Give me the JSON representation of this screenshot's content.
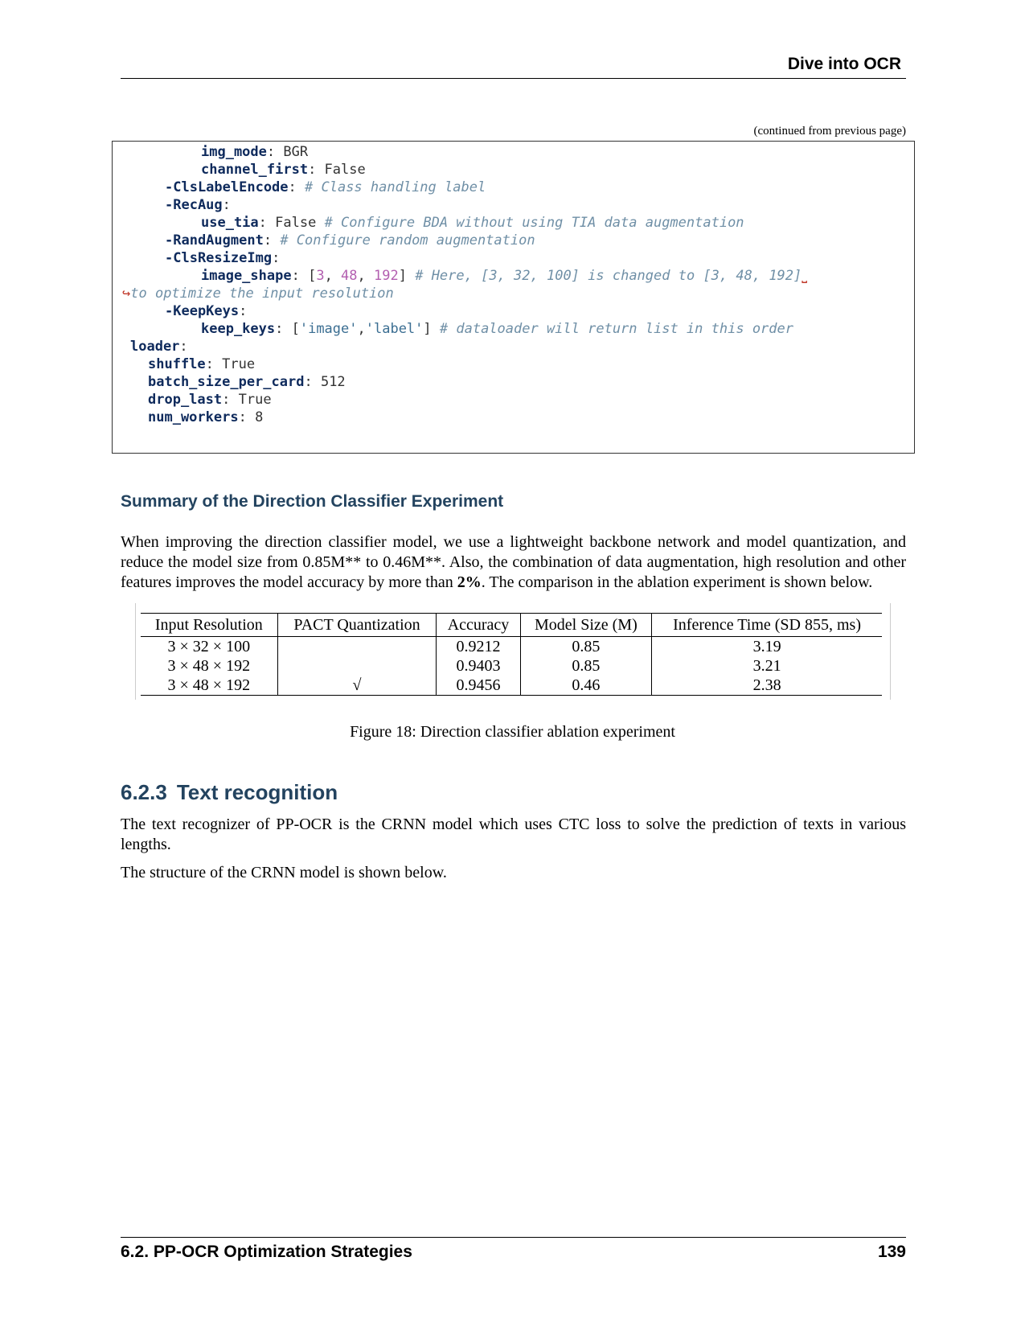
{
  "header": {
    "title": "Dive into OCR"
  },
  "continued_note": "(continued from previous page)",
  "code": {
    "line1": {
      "key": "img_mode",
      "value": " BGR"
    },
    "line2": {
      "key": "channel_first",
      "value": " False"
    },
    "line3": {
      "key": "-ClsLabelEncode",
      "comment": "# Class handling label"
    },
    "line4": {
      "key": "-RecAug"
    },
    "line5": {
      "key": "use_tia",
      "value": " False ",
      "comment": "# Configure BDA without using TIA data augmentation"
    },
    "line6": {
      "key": "-RandAugment",
      "comment": "# Configure random augmentation"
    },
    "line7": {
      "key": "-ClsResizeImg"
    },
    "line8": {
      "key": "image_shape",
      "n1": "3",
      "n2": "48",
      "n3": "192",
      "comment": "# Here, [3, 32, 100] is changed to [3, 48, 192]",
      "wrap_mark": "⎵"
    },
    "line9": {
      "arrow": "↪",
      "comment": "to optimize the input resolution"
    },
    "line10": {
      "key": "-KeepKeys"
    },
    "line11": {
      "key": "keep_keys",
      "s1": "'image'",
      "s2": "'label'",
      "comment": "# dataloader will return list in this order"
    },
    "line12": {
      "key": "loader"
    },
    "line13": {
      "key": "shuffle",
      "value": " True"
    },
    "line14": {
      "key": "batch_size_per_card",
      "value": " 512"
    },
    "line15": {
      "key": "drop_last",
      "value": " True"
    },
    "line16": {
      "key": "num_workers",
      "value": " 8"
    }
  },
  "subsection": {
    "title": "Summary of the Direction Classifier Experiment"
  },
  "summary": {
    "text_before_bold": "When improving the direction classifier model, we use a lightweight backbone network and model quantization, and reduce the model size from 0.85M** to 0.46M**. Also, the combination of data augmentation, high resolution and other features improves the model accuracy by more than ",
    "bold": "2%",
    "text_after_bold": ". The comparison in the ablation experiment is shown below."
  },
  "ablation_table": {
    "headers": [
      "Input Resolution",
      "PACT Quantization",
      "Accuracy",
      "Model Size (M)",
      "Inference Time (SD 855, ms)"
    ],
    "rows": [
      [
        "3 × 32 × 100",
        "",
        "0.9212",
        "0.85",
        "3.19"
      ],
      [
        "3 × 48 × 192",
        "",
        "0.9403",
        "0.85",
        "3.21"
      ],
      [
        "3 × 48 × 192",
        "√",
        "0.9456",
        "0.46",
        "2.38"
      ]
    ]
  },
  "figure_caption": "Figure 18: Direction classifier ablation experiment",
  "section": {
    "number": "6.2.3",
    "title": "Text recognition"
  },
  "text_recognition": {
    "p1": "The text recognizer of PP-OCR is the CRNN model which uses CTC loss to solve the prediction of texts in various lengths.",
    "p2": "The structure of the CRNN model is shown below."
  },
  "footer": {
    "chapter": "6.2.  PP-OCR Optimization Strategies",
    "page_number": "139"
  }
}
